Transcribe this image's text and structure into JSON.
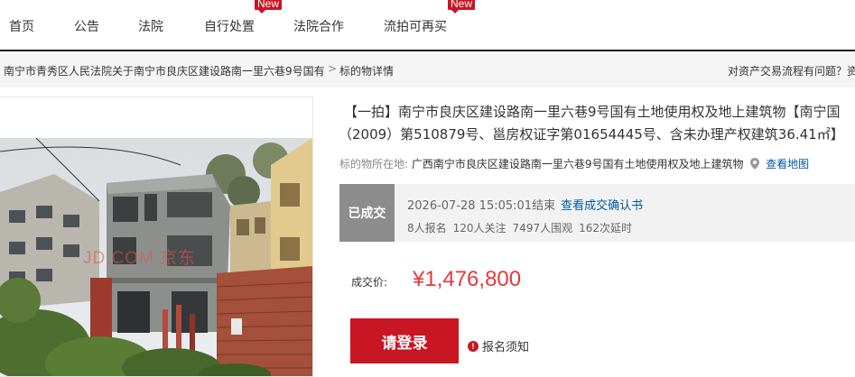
{
  "nav": {
    "items": [
      {
        "label": "首页"
      },
      {
        "label": "公告"
      },
      {
        "label": "法院"
      },
      {
        "label": "自行处置",
        "badge": "New"
      },
      {
        "label": "法院合作"
      },
      {
        "label": "流拍可再买",
        "badge": "New"
      }
    ]
  },
  "breadcrumb": {
    "parent": "南宁市青秀区人民法院关于南宁市良庆区建设路南一里六巷9号国有",
    "separator": ">",
    "current": "标的物详情",
    "help_text": "对资产交易流程有问题？资"
  },
  "item": {
    "image_watermark": "JD.COM 京东",
    "title_line1": "【一拍】南宁市良庆区建设路南一里六巷9号国有土地使用权及地上建筑物【南宁国",
    "title_line2": "（2009）第510879号、邕房权证字第01654445号、含未办理产权建筑36.41㎡】",
    "location_label": "标的物所在地:",
    "location_value": "广西南宁市良庆区建设路南一里六巷9号国有土地使用权及地上建筑物",
    "map_link": "查看地图"
  },
  "status": {
    "tag": "已成交",
    "end_time": "2026-07-28 15:05:01结束",
    "confirm_link": "查看成交确认书",
    "signups": "8人报名",
    "watchers": "120人关注",
    "viewers": "7497人围观",
    "delays": "162次延时"
  },
  "price": {
    "label": "成交价:",
    "value": "¥1,476,800"
  },
  "actions": {
    "login_label": "请登录",
    "notice_label": "报名须知"
  },
  "colors": {
    "accent_red": "#c81623",
    "price_red": "#e4393c",
    "link_blue": "#005aa0",
    "status_gray": "#8c8c8c"
  }
}
